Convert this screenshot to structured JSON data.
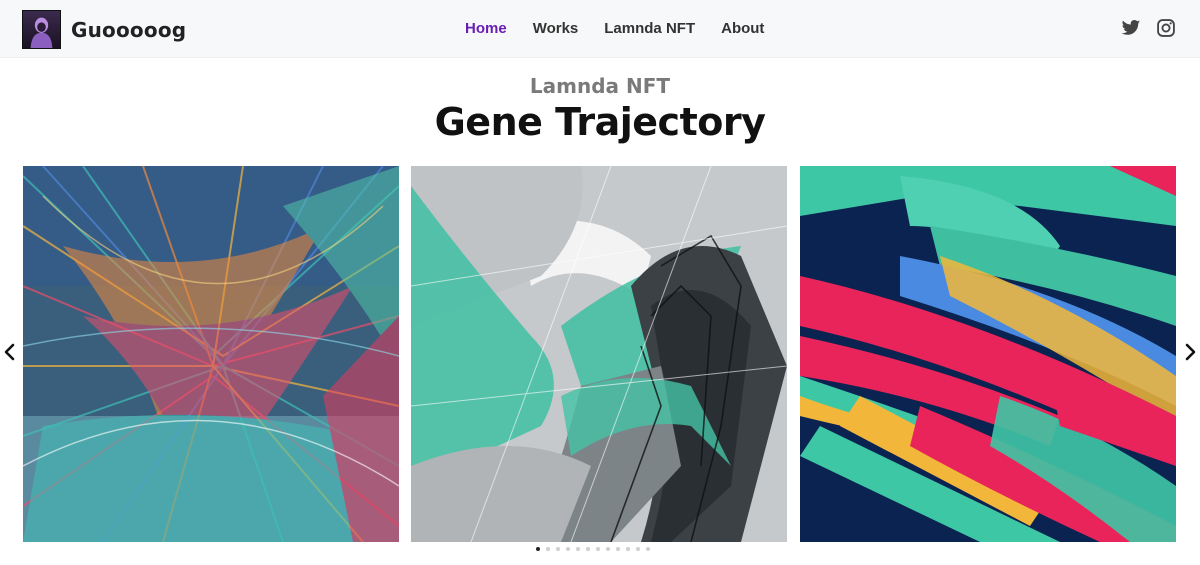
{
  "brand": {
    "name": "Guooooog"
  },
  "nav": {
    "items": [
      {
        "label": "Home",
        "active": true
      },
      {
        "label": "Works",
        "active": false
      },
      {
        "label": "Lamnda NFT",
        "active": false
      },
      {
        "label": "About",
        "active": false
      }
    ]
  },
  "social": {
    "icons": [
      "twitter-icon",
      "instagram-icon"
    ]
  },
  "hero": {
    "subtitle": "Lamnda NFT",
    "title": "Gene Trajectory"
  },
  "carousel": {
    "slide_count": 12,
    "active_index": 0,
    "prev_icon": "chevron-left-icon",
    "next_icon": "chevron-right-icon"
  },
  "colors": {
    "nav_active": "#6a1fb3",
    "nav_text": "#333333",
    "subtitle": "#7a7a7a",
    "title": "#111111",
    "navbar_bg": "#f7f8f9"
  }
}
